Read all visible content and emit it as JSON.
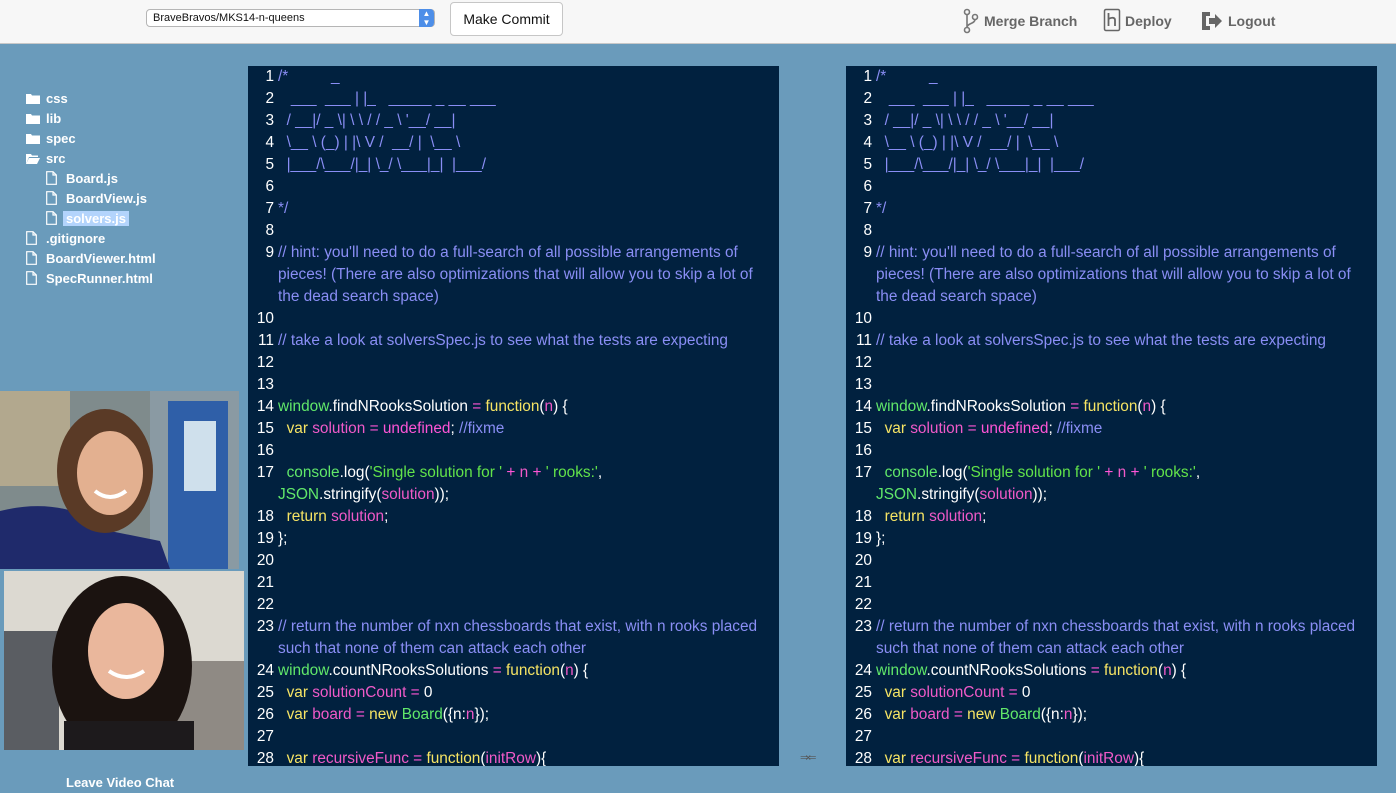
{
  "topbar": {
    "repo_select": "BraveBravos/MKS14-n-queens",
    "commit_label": "Make Commit",
    "merge_label": "Merge Branch",
    "deploy_label": "Deploy",
    "logout_label": "Logout"
  },
  "file_tree": [
    {
      "label": "css",
      "type": "folder",
      "indent": 0
    },
    {
      "label": "lib",
      "type": "folder",
      "indent": 0
    },
    {
      "label": "spec",
      "type": "folder",
      "indent": 0
    },
    {
      "label": "src",
      "type": "folder-open",
      "indent": 0
    },
    {
      "label": "Board.js",
      "type": "file",
      "indent": 1
    },
    {
      "label": "BoardView.js",
      "type": "file",
      "indent": 1
    },
    {
      "label": "solvers.js",
      "type": "file",
      "indent": 1,
      "selected": true
    },
    {
      "label": ".gitignore",
      "type": "file",
      "indent": 0
    },
    {
      "label": "BoardViewer.html",
      "type": "file",
      "indent": 0
    },
    {
      "label": "SpecRunner.html",
      "type": "file",
      "indent": 0
    }
  ],
  "code_lines": [
    {
      "n": "1",
      "t": [
        [
          "cmt",
          "/*          _"
        ]
      ]
    },
    {
      "n": "2",
      "t": [
        [
          "cmt",
          "   ___  ___ | |_   _____ _ __ ___"
        ]
      ]
    },
    {
      "n": "3",
      "t": [
        [
          "cmt",
          "  / __|/ _ \\| \\ \\ / / _ \\ '__/ __|"
        ]
      ]
    },
    {
      "n": "4",
      "t": [
        [
          "cmt",
          "  \\__ \\ (_) | |\\ V /  __/ |  \\__ \\"
        ]
      ]
    },
    {
      "n": "5",
      "t": [
        [
          "cmt",
          "  |___/\\___/|_| \\_/ \\___|_|  |___/"
        ]
      ]
    },
    {
      "n": "6",
      "t": []
    },
    {
      "n": "7",
      "t": [
        [
          "cmt",
          "*/"
        ]
      ]
    },
    {
      "n": "8",
      "t": []
    },
    {
      "n": "9",
      "t": [
        [
          "cmt",
          "// hint: you'll need to do a full-search of all possible arrangements of pieces! (There are also optimizations that will allow you to skip a lot of the dead search space)"
        ]
      ]
    },
    {
      "n": "10",
      "t": []
    },
    {
      "n": "11",
      "t": [
        [
          "cmt",
          "// take a look at solversSpec.js to see what the tests are expecting"
        ]
      ]
    },
    {
      "n": "12",
      "t": []
    },
    {
      "n": "13",
      "t": []
    },
    {
      "n": "14",
      "t": [
        [
          "fn",
          "window"
        ],
        [
          "pl",
          ".findNRooksSolution "
        ],
        [
          "op",
          "="
        ],
        [
          "pl",
          " "
        ],
        [
          "kw",
          "function"
        ],
        [
          "pl",
          "("
        ],
        [
          "vr",
          "n"
        ],
        [
          "pl",
          ") {"
        ]
      ]
    },
    {
      "n": "15",
      "t": [
        [
          "pl",
          "  "
        ],
        [
          "kw",
          "var"
        ],
        [
          "pl",
          " "
        ],
        [
          "vr",
          "solution"
        ],
        [
          "pl",
          " "
        ],
        [
          "op",
          "="
        ],
        [
          "pl",
          " "
        ],
        [
          "op",
          "undefined"
        ],
        [
          "pl",
          "; "
        ],
        [
          "cmt",
          "//fixme"
        ]
      ]
    },
    {
      "n": "16",
      "t": []
    },
    {
      "n": "17",
      "t": [
        [
          "pl",
          "  "
        ],
        [
          "fn",
          "console"
        ],
        [
          "pl",
          ".log("
        ],
        [
          "str",
          "'Single solution for '"
        ],
        [
          "pl",
          " "
        ],
        [
          "op",
          "+"
        ],
        [
          "pl",
          " "
        ],
        [
          "vr",
          "n"
        ],
        [
          "pl",
          " "
        ],
        [
          "op",
          "+"
        ],
        [
          "pl",
          " "
        ],
        [
          "str",
          "' rooks:'"
        ],
        [
          "pl",
          ", "
        ],
        [
          "fn",
          "JSON"
        ],
        [
          "pl",
          ".stringify("
        ],
        [
          "vr",
          "solution"
        ],
        [
          "pl",
          "));"
        ]
      ]
    },
    {
      "n": "18",
      "t": [
        [
          "pl",
          "  "
        ],
        [
          "kw",
          "return"
        ],
        [
          "pl",
          " "
        ],
        [
          "vr",
          "solution"
        ],
        [
          "pl",
          ";"
        ]
      ]
    },
    {
      "n": "19",
      "t": [
        [
          "pl",
          "};"
        ]
      ]
    },
    {
      "n": "20",
      "t": []
    },
    {
      "n": "21",
      "t": []
    },
    {
      "n": "22",
      "t": []
    },
    {
      "n": "23",
      "t": [
        [
          "cmt",
          "// return the number of nxn chessboards that exist, with n rooks placed such that none of them can attack each other"
        ]
      ]
    },
    {
      "n": "24",
      "t": [
        [
          "fn",
          "window"
        ],
        [
          "pl",
          ".countNRooksSolutions "
        ],
        [
          "op",
          "="
        ],
        [
          "pl",
          " "
        ],
        [
          "kw",
          "function"
        ],
        [
          "pl",
          "("
        ],
        [
          "vr",
          "n"
        ],
        [
          "pl",
          ") {"
        ]
      ]
    },
    {
      "n": "25",
      "t": [
        [
          "pl",
          "  "
        ],
        [
          "kw",
          "var"
        ],
        [
          "pl",
          " "
        ],
        [
          "vr",
          "solutionCount"
        ],
        [
          "pl",
          " "
        ],
        [
          "op",
          "="
        ],
        [
          "pl",
          " 0"
        ]
      ]
    },
    {
      "n": "26",
      "t": [
        [
          "pl",
          "  "
        ],
        [
          "kw",
          "var"
        ],
        [
          "pl",
          " "
        ],
        [
          "vr",
          "board"
        ],
        [
          "pl",
          " "
        ],
        [
          "op",
          "="
        ],
        [
          "pl",
          " "
        ],
        [
          "kw",
          "new"
        ],
        [
          "pl",
          " "
        ],
        [
          "fn",
          "Board"
        ],
        [
          "pl",
          "({n:"
        ],
        [
          "vr",
          "n"
        ],
        [
          "pl",
          "});"
        ]
      ]
    },
    {
      "n": "27",
      "t": []
    },
    {
      "n": "28",
      "t": [
        [
          "pl",
          "  "
        ],
        [
          "kw",
          "var"
        ],
        [
          "pl",
          " "
        ],
        [
          "vr",
          "recursiveFunc"
        ],
        [
          "pl",
          " "
        ],
        [
          "op",
          "="
        ],
        [
          "pl",
          " "
        ],
        [
          "kw",
          "function"
        ],
        [
          "pl",
          "("
        ],
        [
          "vr",
          "initRow"
        ],
        [
          "pl",
          "){"
        ]
      ]
    }
  ],
  "swap_icon": "⇒⇐",
  "video_chat": {
    "leave_label": "Leave Video Chat"
  },
  "colors": {
    "page_bg": "#6a9bbb",
    "editor_bg": "#01213f",
    "comment": "#8a8ef5",
    "keyword": "#f6e464",
    "function": "#61e86a",
    "operator": "#ff55d6",
    "string": "#62e34a"
  }
}
